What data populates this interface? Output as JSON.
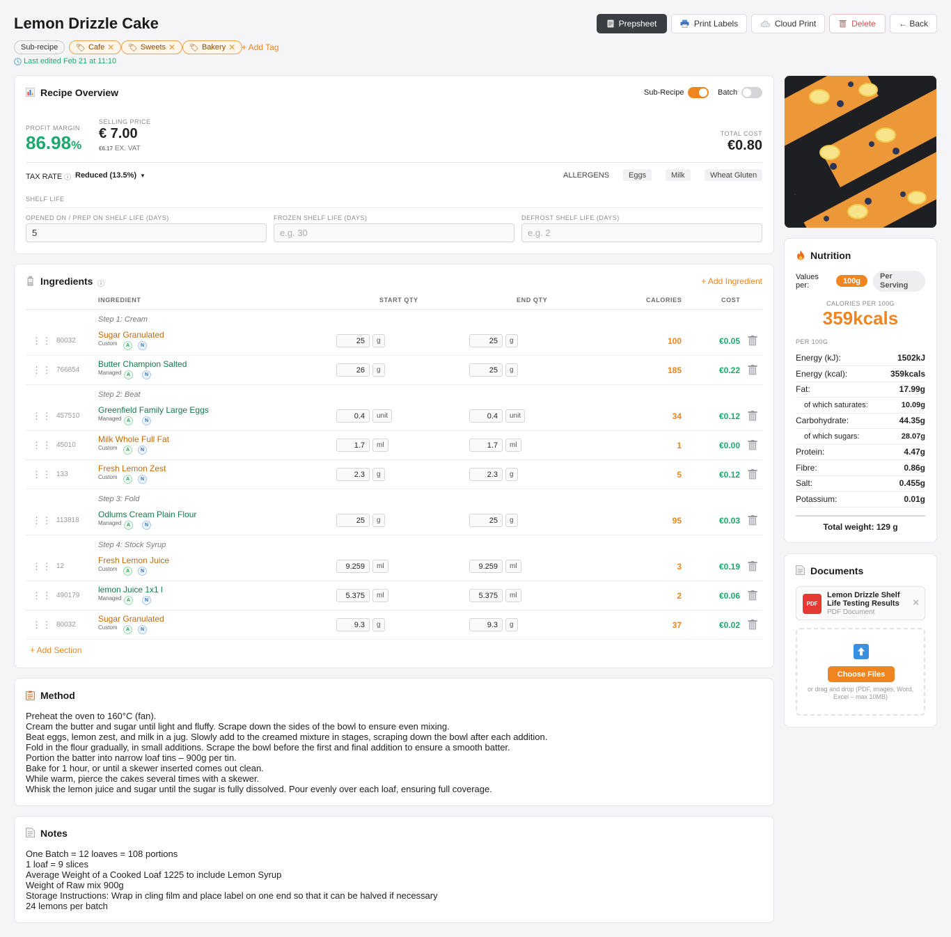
{
  "header": {
    "title": "Lemon Drizzle Cake",
    "buttons": {
      "prepsheet": "Prepsheet",
      "print_labels": "Print Labels",
      "cloud_print": "Cloud Print",
      "delete": "Delete",
      "back": "← Back"
    },
    "tags": {
      "subrecipe": "Sub-recipe",
      "items": [
        "Cafe",
        "Sweets",
        "Bakery"
      ],
      "add": "+ Add Tag"
    },
    "last_edited": "Last edited Feb 21 at 11:10"
  },
  "overview": {
    "title": "Recipe Overview",
    "subrecipe_toggle": {
      "label": "Sub-Recipe",
      "on": true
    },
    "batch_toggle": {
      "label": "Batch",
      "on": false
    },
    "profit_margin_label": "PROFIT MARGIN",
    "profit_margin": "86.98",
    "profit_pct": "%",
    "selling_price_label": "SELLING PRICE",
    "selling_price": "€ 7.00",
    "ex_vat_value": "€6.17",
    "ex_vat_label": "EX. VAT",
    "total_cost_label": "TOTAL COST",
    "total_cost": "€0.80",
    "tax_rate_label": "TAX RATE",
    "tax_rate_value": "Reduced (13.5%)",
    "allergens_label": "ALLERGENS",
    "allergens": [
      "Eggs",
      "Milk",
      "Wheat Gluten"
    ],
    "shelf_life_label": "SHELF LIFE",
    "opened_label": "OPENED ON / PREP ON SHELF LIFE (DAYS)",
    "opened_value": "5",
    "frozen_label": "FROZEN SHELF LIFE (DAYS)",
    "frozen_placeholder": "e.g. 30",
    "defrost_label": "DEFROST SHELF LIFE (DAYS)",
    "defrost_placeholder": "e.g. 2"
  },
  "ingredients": {
    "title": "Ingredients",
    "add": "+ Add Ingredient",
    "add_section": "+ Add Section",
    "headers": {
      "ingredient": "INGREDIENT",
      "start": "START QTY",
      "end": "END QTY",
      "calories": "CALORIES",
      "cost": "COST"
    },
    "steps": [
      "Step 1: Cream",
      "Step 2: Beat",
      "Step 3: Fold",
      "Step 4: Stock Syrup"
    ],
    "rows": [
      {
        "code": "80032",
        "name": "Sugar Granulated",
        "type": "Custom",
        "start": "25",
        "start_unit": "g",
        "end": "25",
        "end_unit": "g",
        "calories": "100",
        "cost": "€0.05"
      },
      {
        "code": "766854",
        "name": "Butter Champion Salted",
        "type": "Managed",
        "start": "26",
        "start_unit": "g",
        "end": "25",
        "end_unit": "g",
        "calories": "185",
        "cost": "€0.22"
      },
      {
        "code": "457510",
        "name": "Greenfield Family Large Eggs",
        "type": "Managed",
        "start": "0.4",
        "start_unit": "unit",
        "end": "0.4",
        "end_unit": "unit",
        "calories": "34",
        "cost": "€0.12"
      },
      {
        "code": "45010",
        "name": "Milk Whole Full Fat",
        "type": "Custom",
        "start": "1.7",
        "start_unit": "ml",
        "end": "1.7",
        "end_unit": "ml",
        "calories": "1",
        "cost": "€0.00"
      },
      {
        "code": "133",
        "name": "Fresh Lemon Zest",
        "type": "Custom",
        "start": "2.3",
        "start_unit": "g",
        "end": "2.3",
        "end_unit": "g",
        "calories": "5",
        "cost": "€0.12"
      },
      {
        "code": "113818",
        "name": "Odlums Cream Plain Flour",
        "type": "Managed",
        "start": "25",
        "start_unit": "g",
        "end": "25",
        "end_unit": "g",
        "calories": "95",
        "cost": "€0.03"
      },
      {
        "code": "12",
        "name": "Fresh Lemon Juice",
        "type": "Custom",
        "start": "9.259",
        "start_unit": "ml",
        "end": "9.259",
        "end_unit": "ml",
        "calories": "3",
        "cost": "€0.19"
      },
      {
        "code": "490179",
        "name": "lemon Juice 1x1 l",
        "type": "Managed",
        "start": "5.375",
        "start_unit": "ml",
        "end": "5.375",
        "end_unit": "ml",
        "calories": "2",
        "cost": "€0.06"
      },
      {
        "code": "80032",
        "name": "Sugar Granulated",
        "type": "Custom",
        "start": "9.3",
        "start_unit": "g",
        "end": "9.3",
        "end_unit": "g",
        "calories": "37",
        "cost": "€0.02"
      }
    ]
  },
  "method": {
    "title": "Method",
    "lines": [
      "Preheat the oven to 160°C (fan).",
      "Cream the butter and sugar until light and fluffy. Scrape down the sides of the bowl to ensure even mixing.",
      "Beat eggs, lemon zest, and milk in a jug. Slowly add to the creamed mixture in stages, scraping down the bowl after each addition.",
      "Fold in the flour gradually, in small additions. Scrape the bowl before the first and final addition to ensure a smooth batter.",
      "Portion the batter into narrow loaf tins – 900g per tin.",
      "Bake for 1 hour, or until a skewer inserted comes out clean.",
      "While warm, pierce the cakes several times with a skewer.",
      "Whisk the lemon juice and sugar until the sugar is fully dissolved. Pour evenly over each loaf, ensuring full coverage."
    ]
  },
  "notes": {
    "title": "Notes",
    "lines": [
      "One Batch = 12 loaves = 108 portions",
      "1 loaf = 9 slices",
      "Average Weight of a Cooked Loaf 1225 to include Lemon Syrup",
      "Weight of Raw mix 900g",
      "Storage Instructions: Wrap in cling film and place label on one end so that it can be halved if necessary",
      "24 lemons per batch"
    ]
  },
  "nutrition": {
    "title": "Nutrition",
    "values_per": "Values per:",
    "opt_100g": "100g",
    "opt_serving": "Per Serving",
    "cal_label": "CALORIES PER 100G",
    "cal_value": "359kcals",
    "per_label": "PER 100G",
    "rows": [
      {
        "label": "Energy (kJ):",
        "value": "1502kJ",
        "sub": false
      },
      {
        "label": "Energy (kcal):",
        "value": "359kcals",
        "sub": false
      },
      {
        "label": "Fat:",
        "value": "17.99g",
        "sub": false
      },
      {
        "label": "of which saturates:",
        "value": "10.09g",
        "sub": true
      },
      {
        "label": "Carbohydrate:",
        "value": "44.35g",
        "sub": false
      },
      {
        "label": "of which sugars:",
        "value": "28.07g",
        "sub": true
      },
      {
        "label": "Protein:",
        "value": "4.47g",
        "sub": false
      },
      {
        "label": "Fibre:",
        "value": "0.86g",
        "sub": false
      },
      {
        "label": "Salt:",
        "value": "0.455g",
        "sub": false
      },
      {
        "label": "Potassium:",
        "value": "0.01g",
        "sub": false
      }
    ],
    "total_weight": "Total weight: 129 g"
  },
  "documents": {
    "title": "Documents",
    "file_badge": "PDF",
    "file_name": "Lemon Drizzle Shelf Life Testing Results",
    "file_type": "PDF Document",
    "choose": "Choose Files",
    "hint": "or drag and drop (PDF, images, Word, Excel – max 10MB)"
  },
  "colors": {
    "accent": "#f0851f",
    "green": "#1aaa6c",
    "dark": "#3a3d42"
  }
}
